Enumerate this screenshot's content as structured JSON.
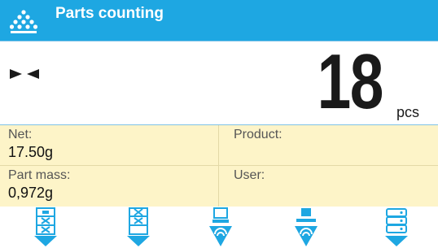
{
  "header": {
    "title": "Parts counting",
    "app_icon": "parts-counting-icon"
  },
  "display": {
    "value": "18",
    "unit": "pcs",
    "stability_icon": "stability-indicator-icon"
  },
  "info": {
    "net_label": "Net:",
    "net_value": "17.50g",
    "product_label": "Product:",
    "product_value": "",
    "part_mass_label": "Part mass:",
    "part_mass_value": "0,972g",
    "user_label": "User:",
    "user_value": ""
  },
  "softkeys": [
    {
      "icon": "sample-quantity-key-icon"
    },
    {
      "icon": "part-mass-entry-key-icon"
    },
    {
      "icon": "set-from-database-key-icon"
    },
    {
      "icon": "tare-key-icon"
    },
    {
      "icon": "database-key-icon"
    }
  ],
  "colors": {
    "accent": "#1ea7e2",
    "info_bg": "#fdf4c8"
  }
}
